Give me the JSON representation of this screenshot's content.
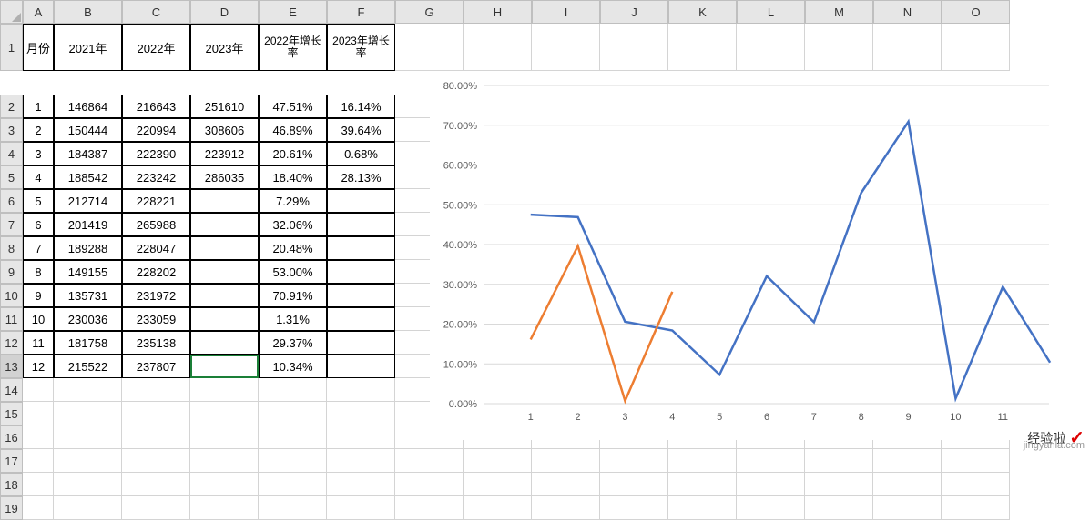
{
  "columns": [
    "A",
    "B",
    "C",
    "D",
    "E",
    "F",
    "G",
    "H",
    "I",
    "J",
    "K",
    "L",
    "M",
    "N",
    "O"
  ],
  "row_count": 19,
  "selected_row": 13,
  "headers": {
    "A": "月份",
    "B": "2021年",
    "C": "2022年",
    "D": "2023年",
    "E": "2022年增长率",
    "F": "2023年增长率"
  },
  "table": [
    {
      "m": "1",
      "y21": "146864",
      "y22": "216643",
      "y23": "251610",
      "g22": "47.51%",
      "g23": "16.14%"
    },
    {
      "m": "2",
      "y21": "150444",
      "y22": "220994",
      "y23": "308606",
      "g22": "46.89%",
      "g23": "39.64%"
    },
    {
      "m": "3",
      "y21": "184387",
      "y22": "222390",
      "y23": "223912",
      "g22": "20.61%",
      "g23": "0.68%"
    },
    {
      "m": "4",
      "y21": "188542",
      "y22": "223242",
      "y23": "286035",
      "g22": "18.40%",
      "g23": "28.13%"
    },
    {
      "m": "5",
      "y21": "212714",
      "y22": "228221",
      "y23": "",
      "g22": "7.29%",
      "g23": ""
    },
    {
      "m": "6",
      "y21": "201419",
      "y22": "265988",
      "y23": "",
      "g22": "32.06%",
      "g23": ""
    },
    {
      "m": "7",
      "y21": "189288",
      "y22": "228047",
      "y23": "",
      "g22": "20.48%",
      "g23": ""
    },
    {
      "m": "8",
      "y21": "149155",
      "y22": "228202",
      "y23": "",
      "g22": "53.00%",
      "g23": ""
    },
    {
      "m": "9",
      "y21": "135731",
      "y22": "231972",
      "y23": "",
      "g22": "70.91%",
      "g23": ""
    },
    {
      "m": "10",
      "y21": "230036",
      "y22": "233059",
      "y23": "",
      "g22": "1.31%",
      "g23": ""
    },
    {
      "m": "11",
      "y21": "181758",
      "y22": "235138",
      "y23": "",
      "g22": "29.37%",
      "g23": ""
    },
    {
      "m": "12",
      "y21": "215522",
      "y22": "237807",
      "y23": "",
      "g22": "10.34%",
      "g23": ""
    }
  ],
  "chart_data": {
    "type": "line",
    "categories": [
      "1",
      "2",
      "3",
      "4",
      "5",
      "6",
      "7",
      "8",
      "9",
      "10",
      "11",
      "12"
    ],
    "series": [
      {
        "name": "2022年增长率",
        "color": "#4472c4",
        "values": [
          47.51,
          46.89,
          20.61,
          18.4,
          7.29,
          32.06,
          20.48,
          53.0,
          70.91,
          1.31,
          29.37,
          10.34
        ]
      },
      {
        "name": "2023年增长率",
        "color": "#ed7d31",
        "values": [
          16.14,
          39.64,
          0.68,
          28.13,
          null,
          null,
          null,
          null,
          null,
          null,
          null,
          null
        ]
      }
    ],
    "y_ticks": [
      "0.00%",
      "10.00%",
      "20.00%",
      "30.00%",
      "40.00%",
      "50.00%",
      "60.00%",
      "70.00%",
      "80.00%"
    ],
    "x_ticks": [
      "1",
      "2",
      "3",
      "4",
      "5",
      "6",
      "7",
      "8",
      "9",
      "10",
      "11"
    ],
    "ylim": [
      0,
      80
    ],
    "ylabel": "",
    "xlabel": "",
    "title": ""
  },
  "watermark": {
    "text1": "经验啦",
    "text2": "jingyanla.com"
  }
}
